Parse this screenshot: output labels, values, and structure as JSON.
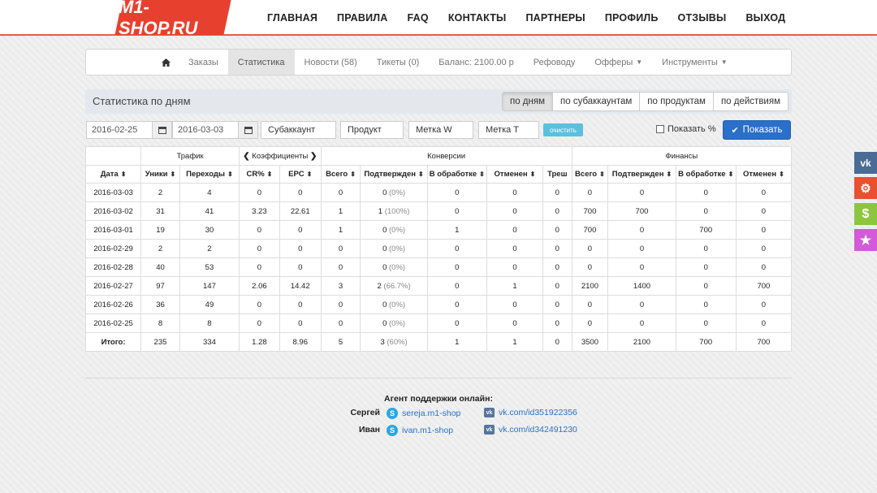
{
  "logo": "M1-SHOP.RU",
  "topnav": [
    "ГЛАВНАЯ",
    "ПРАВИЛА",
    "FAQ",
    "КОНТАКТЫ",
    "ПАРТНЕРЫ",
    "ПРОФИЛЬ",
    "ОТЗЫВЫ",
    "ВЫХОД"
  ],
  "subnav": {
    "orders": "Заказы",
    "stats": "Статистика",
    "news": "Новости (58)",
    "tickets": "Тикеты (0)",
    "balance": "Баланс: 2100.00 р",
    "refs": "Рефоводу",
    "offers": "Офферы",
    "tools": "Инструменты"
  },
  "panel": {
    "title": "Статистика по дням",
    "tabs": [
      "по дням",
      "по субаккаунтам",
      "по продуктам",
      "по действиям"
    ]
  },
  "filters": {
    "date_from": "2016-02-25",
    "date_to": "2016-03-03",
    "subaccount": "Субаккаунт",
    "product": "Продукт",
    "tag_w": "Метка W",
    "tag_t": "Метка T",
    "clear": "очистить",
    "show_pct": "Показать %",
    "show": "Показать"
  },
  "table": {
    "groups": {
      "traffic": "Трафик",
      "coef": "Коэффициенты",
      "conv": "Конверсии",
      "fin": "Финансы"
    },
    "headers": [
      "Дата",
      "Уники",
      "Переходы",
      "CR%",
      "EPC",
      "Всего",
      "Подтвержден",
      "В обработке",
      "Отменен",
      "Треш",
      "Всего",
      "Подтвержден",
      "В обработке",
      "Отменен"
    ],
    "rows": [
      [
        "2016-03-03",
        "2",
        "4",
        "0",
        "0",
        "0",
        "0",
        "(0%)",
        "0",
        "0",
        "0",
        "0",
        "0",
        "0",
        "0"
      ],
      [
        "2016-03-02",
        "31",
        "41",
        "3.23",
        "22.61",
        "1",
        "1",
        "(100%)",
        "0",
        "0",
        "0",
        "700",
        "700",
        "0",
        "0"
      ],
      [
        "2016-03-01",
        "19",
        "30",
        "0",
        "0",
        "1",
        "0",
        "(0%)",
        "1",
        "0",
        "0",
        "700",
        "0",
        "700",
        "0"
      ],
      [
        "2016-02-29",
        "2",
        "2",
        "0",
        "0",
        "0",
        "0",
        "(0%)",
        "0",
        "0",
        "0",
        "0",
        "0",
        "0",
        "0"
      ],
      [
        "2016-02-28",
        "40",
        "53",
        "0",
        "0",
        "0",
        "0",
        "(0%)",
        "0",
        "0",
        "0",
        "0",
        "0",
        "0",
        "0"
      ],
      [
        "2016-02-27",
        "97",
        "147",
        "2.06",
        "14.42",
        "3",
        "2",
        "(66.7%)",
        "0",
        "1",
        "0",
        "2100",
        "1400",
        "0",
        "700"
      ],
      [
        "2016-02-26",
        "36",
        "49",
        "0",
        "0",
        "0",
        "0",
        "(0%)",
        "0",
        "0",
        "0",
        "0",
        "0",
        "0",
        "0"
      ],
      [
        "2016-02-25",
        "8",
        "8",
        "0",
        "0",
        "0",
        "0",
        "(0%)",
        "0",
        "0",
        "0",
        "0",
        "0",
        "0",
        "0"
      ]
    ],
    "total": [
      "Итого:",
      "235",
      "334",
      "1.28",
      "8.96",
      "5",
      "3",
      "(60%)",
      "1",
      "1",
      "0",
      "3500",
      "2100",
      "700",
      "700"
    ]
  },
  "support": {
    "title": "Агент поддержки онлайн:",
    "agents": [
      {
        "name": "Сергей",
        "skype": "sereja.m1-shop",
        "vk": "vk.com/id351922356"
      },
      {
        "name": "Иван",
        "skype": "ivan.m1-shop",
        "vk": "vk.com/id342491230"
      }
    ]
  },
  "side_buttons": [
    {
      "icon": "vk-icon",
      "color": "#4a6b94"
    },
    {
      "icon": "gear-icon",
      "color": "#e8512e"
    },
    {
      "icon": "dollar-icon",
      "color": "#8cc63e"
    },
    {
      "icon": "star-icon",
      "color": "#d15bd8"
    }
  ],
  "colors": {
    "accent": "#e8402f",
    "primary": "#2a6fc9",
    "info": "#5bc0de"
  }
}
